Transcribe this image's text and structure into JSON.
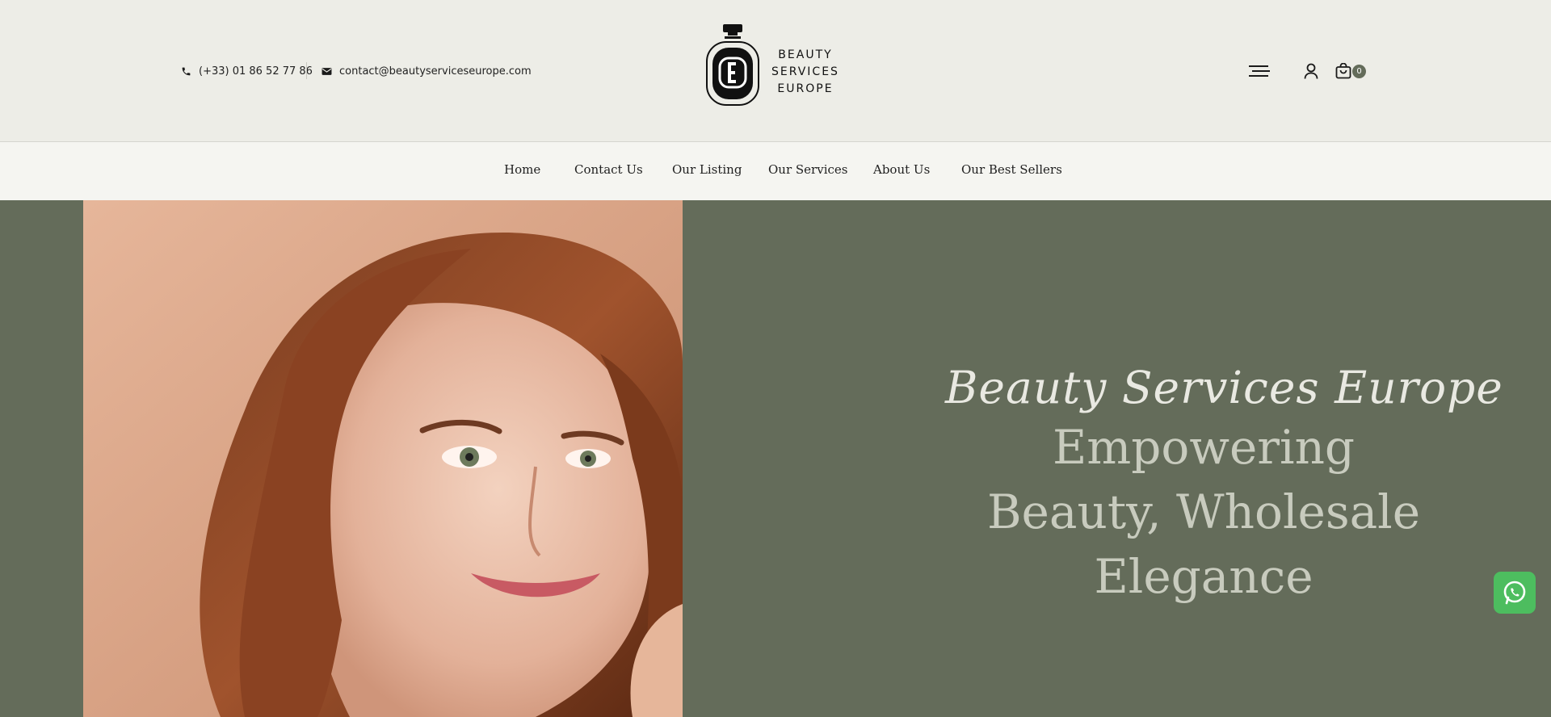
{
  "header": {
    "phone": "(+33) 01 86 52 77 86",
    "email": "contact@beautyserviceseurope.com",
    "logo": {
      "lines": [
        "BEAUTY",
        "SERVICES",
        "EUROPE"
      ]
    },
    "icons": {
      "phone": "phone-icon",
      "email": "envelope-icon",
      "menu": "menu-icon",
      "user": "user-icon",
      "cart": "shopping-bag-icon"
    },
    "cart_count": "0"
  },
  "nav": {
    "items": [
      {
        "label": "Home"
      },
      {
        "label": "Contact Us"
      },
      {
        "label": "Our Listing"
      },
      {
        "label": "Our Services"
      },
      {
        "label": "About Us"
      },
      {
        "label": "Our Best Sellers"
      }
    ]
  },
  "hero": {
    "script_title": "Beauty Services Europe",
    "headline_lines": [
      "Empowering",
      "Beauty, Wholesale",
      "Elegance"
    ]
  },
  "floating": {
    "whatsapp_icon": "whatsapp-icon"
  },
  "colors": {
    "header_bg": "#edede7",
    "nav_bg": "#f5f5f1",
    "hero_bg": "#646c5a",
    "headline": "#c8cbbe",
    "whatsapp": "#4dbd5f"
  }
}
